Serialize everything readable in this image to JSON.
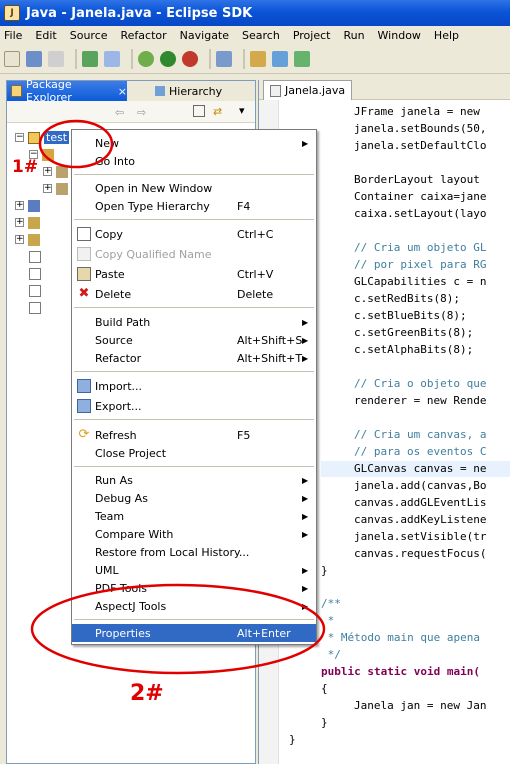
{
  "window": {
    "title": "Java - Janela.java - Eclipse SDK"
  },
  "menubar": [
    "File",
    "Edit",
    "Source",
    "Refactor",
    "Navigate",
    "Search",
    "Project",
    "Run",
    "Window",
    "Help"
  ],
  "left_pane": {
    "tab_active": "Package Explorer",
    "tab_other": "Hierarchy",
    "project": "test"
  },
  "editor": {
    "tab": "Janela.java",
    "lines": [
      "JFrame janela = new",
      "janela.setBounds(50,",
      "janela.setDefaultClo",
      "",
      "BorderLayout layout",
      "Container caixa=jane",
      "caixa.setLayout(layo",
      "",
      "// Cria um objeto GL",
      "// por pixel para RG",
      "GLCapabilities c = n",
      "c.setRedBits(8);",
      "c.setBlueBits(8);",
      "c.setGreenBits(8);",
      "c.setAlphaBits(8);",
      "",
      "// Cria o objeto que",
      "renderer = new Rende",
      "",
      "// Cria um canvas, a",
      "// para os eventos C",
      "GLCanvas canvas = ne",
      "janela.add(canvas,Bo",
      "canvas.addGLEventLis",
      "canvas.addKeyListene",
      "janela.setVisible(tr",
      "canvas.requestFocus("
    ],
    "tail": {
      "brace1": "}",
      "jdoc1": "/**",
      "jdoc2": " *",
      "jdoc3": " * Método main que apena",
      "jdoc4": " */",
      "main": "public static void main(",
      "brace2": "{",
      "jan": "Janela jan = new Jan",
      "brace3": "}",
      "brace4": "}"
    }
  },
  "context_menu": {
    "items": [
      {
        "label": "New",
        "shortcut": "",
        "submenu": true
      },
      {
        "label": "Go Into",
        "shortcut": "",
        "submenu": false
      },
      {
        "label": "Open in New Window",
        "shortcut": "",
        "submenu": false
      },
      {
        "label": "Open Type Hierarchy",
        "shortcut": "F4",
        "submenu": false
      },
      {
        "label": "Copy",
        "shortcut": "Ctrl+C",
        "submenu": false
      },
      {
        "label": "Copy Qualified Name",
        "shortcut": "",
        "submenu": false
      },
      {
        "label": "Paste",
        "shortcut": "Ctrl+V",
        "submenu": false
      },
      {
        "label": "Delete",
        "shortcut": "Delete",
        "submenu": false
      },
      {
        "label": "Build Path",
        "shortcut": "",
        "submenu": true
      },
      {
        "label": "Source",
        "shortcut": "Alt+Shift+S",
        "submenu": true
      },
      {
        "label": "Refactor",
        "shortcut": "Alt+Shift+T",
        "submenu": true
      },
      {
        "label": "Import...",
        "shortcut": "",
        "submenu": false
      },
      {
        "label": "Export...",
        "shortcut": "",
        "submenu": false
      },
      {
        "label": "Refresh",
        "shortcut": "F5",
        "submenu": false
      },
      {
        "label": "Close Project",
        "shortcut": "",
        "submenu": false
      },
      {
        "label": "Run As",
        "shortcut": "",
        "submenu": true
      },
      {
        "label": "Debug As",
        "shortcut": "",
        "submenu": true
      },
      {
        "label": "Team",
        "shortcut": "",
        "submenu": true
      },
      {
        "label": "Compare With",
        "shortcut": "",
        "submenu": true
      },
      {
        "label": "Restore from Local History...",
        "shortcut": "",
        "submenu": false
      },
      {
        "label": "UML",
        "shortcut": "",
        "submenu": true
      },
      {
        "label": "PDF Tools",
        "shortcut": "",
        "submenu": true
      },
      {
        "label": "AspectJ Tools",
        "shortcut": "",
        "submenu": true
      },
      {
        "label": "Properties",
        "shortcut": "Alt+Enter",
        "submenu": false
      }
    ]
  },
  "annotations": {
    "a1": "1#",
    "a2": "2#"
  },
  "colors": {
    "title_bar": "#0a54d6",
    "selection": "#316ac5",
    "annotation": "#e10000"
  }
}
